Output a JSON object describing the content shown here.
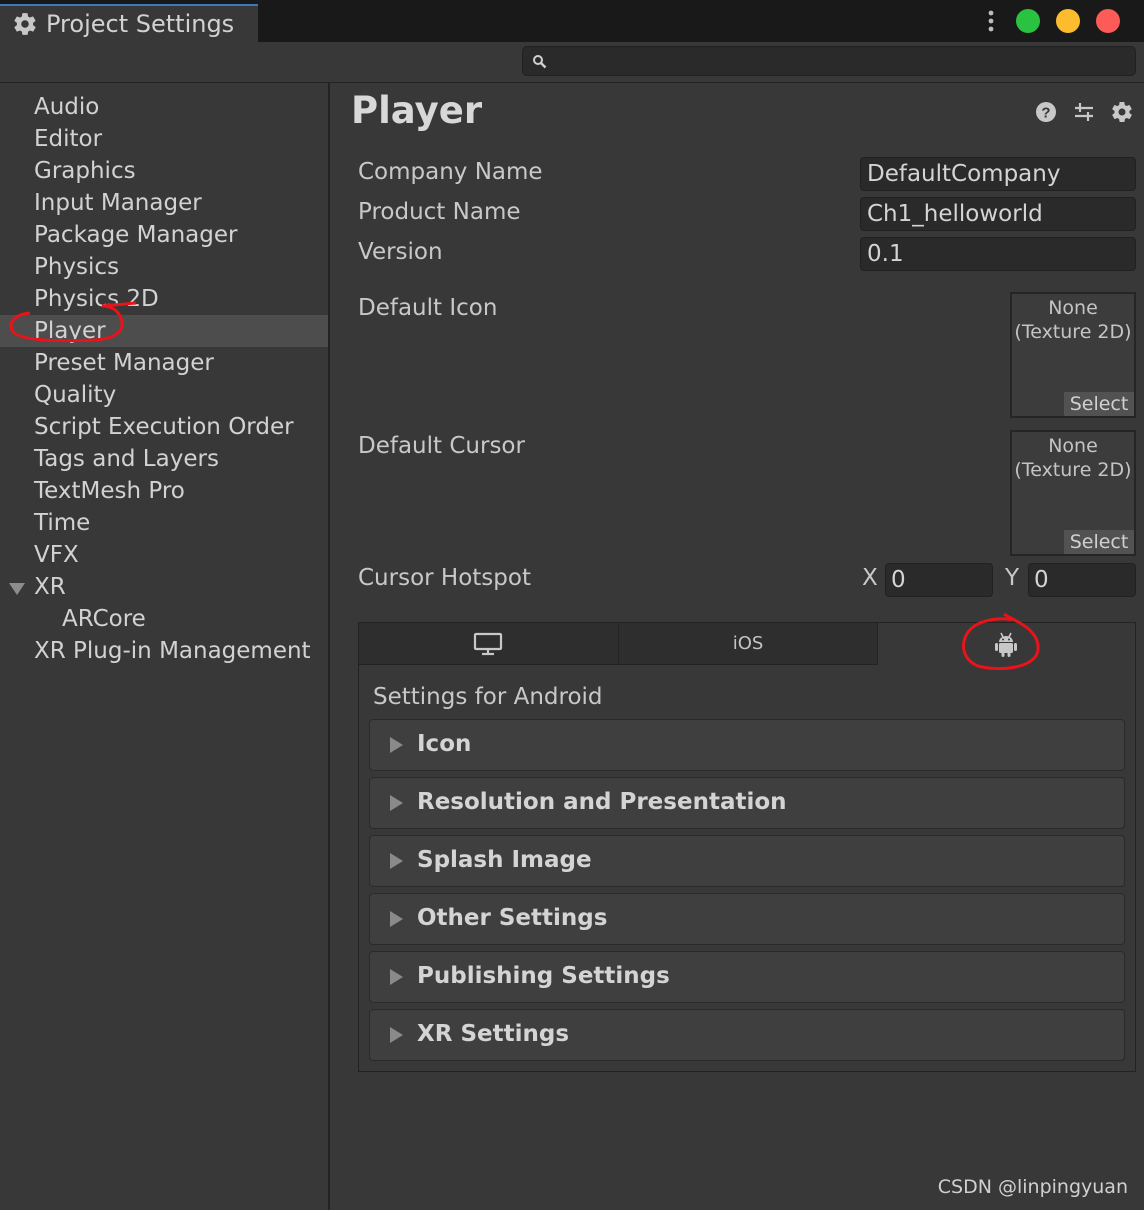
{
  "window": {
    "tab_title": "Project Settings",
    "traffic_colors": [
      "#29c341",
      "#fdbc2e",
      "#fc5b57"
    ]
  },
  "search": {
    "value": ""
  },
  "sidebar": {
    "items": [
      {
        "label": "Audio"
      },
      {
        "label": "Editor"
      },
      {
        "label": "Graphics"
      },
      {
        "label": "Input Manager"
      },
      {
        "label": "Package Manager"
      },
      {
        "label": "Physics"
      },
      {
        "label": "Physics 2D"
      },
      {
        "label": "Player"
      },
      {
        "label": "Preset Manager"
      },
      {
        "label": "Quality"
      },
      {
        "label": "Script Execution Order"
      },
      {
        "label": "Tags and Layers"
      },
      {
        "label": "TextMesh Pro"
      },
      {
        "label": "Time"
      },
      {
        "label": "VFX"
      },
      {
        "label": "XR"
      },
      {
        "label": "ARCore"
      },
      {
        "label": "XR Plug-in Management"
      }
    ],
    "selected": "Player"
  },
  "main": {
    "title": "Player",
    "company_label": "Company Name",
    "company_value": "DefaultCompany",
    "product_label": "Product Name",
    "product_value": "Ch1_helloworld",
    "version_label": "Version",
    "version_value": "0.1",
    "default_icon_label": "Default Icon",
    "default_cursor_label": "Default Cursor",
    "obj_none": "None",
    "obj_type": "(Texture 2D)",
    "obj_select": "Select",
    "hotspot_label": "Cursor Hotspot",
    "hotspot_x_label": "X",
    "hotspot_x": "0",
    "hotspot_y_label": "Y",
    "hotspot_y": "0"
  },
  "platform_tabs": {
    "ios_label": "iOS",
    "active": "Android",
    "settings_for": "Settings for Android",
    "sections": [
      "Icon",
      "Resolution and Presentation",
      "Splash Image",
      "Other Settings",
      "Publishing Settings",
      "XR Settings"
    ]
  },
  "watermark": "CSDN @linpingyuan",
  "annotation_color": "#e8131b"
}
